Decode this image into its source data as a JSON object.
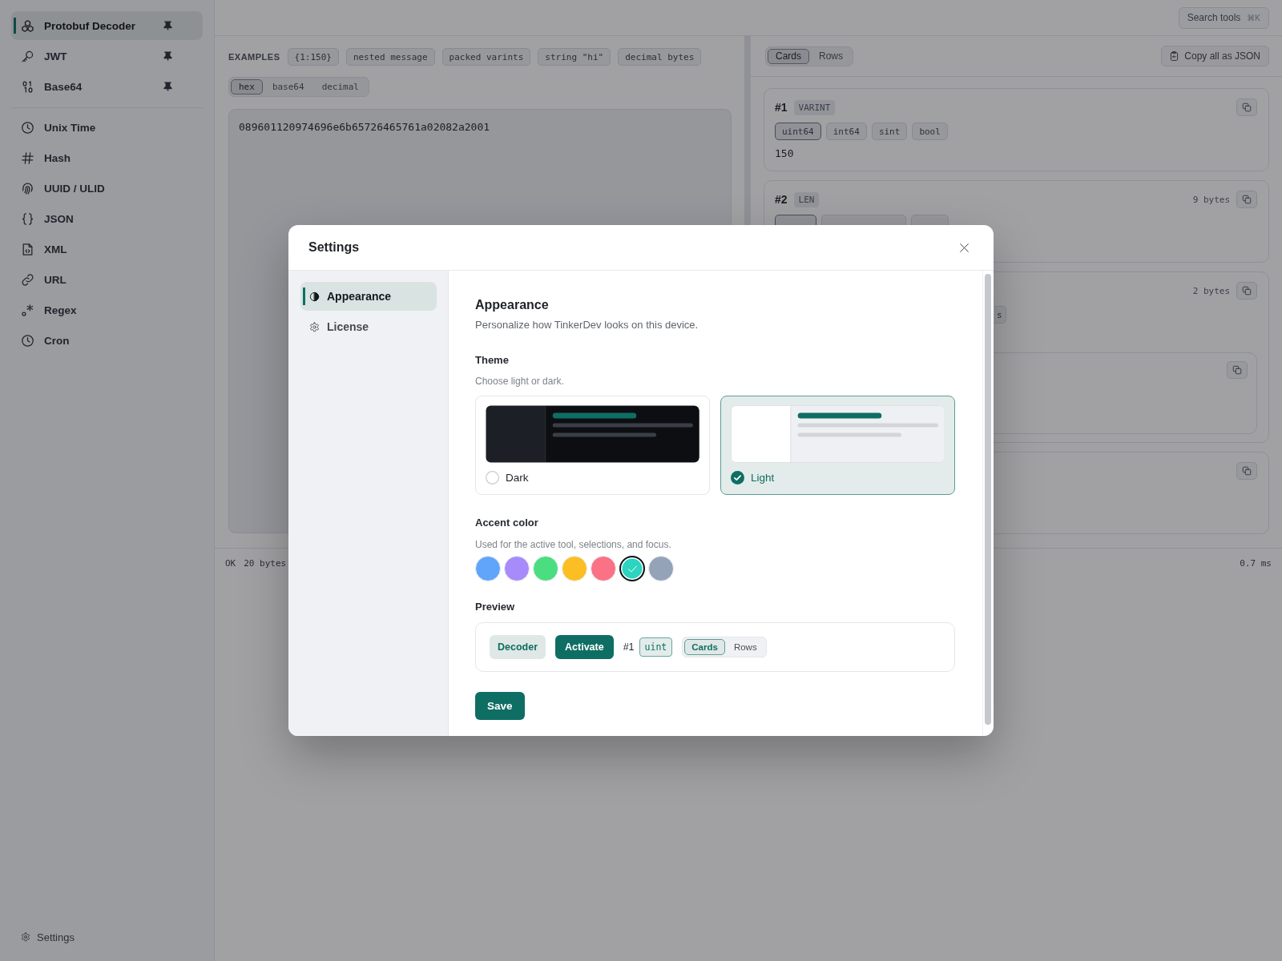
{
  "sidebar": {
    "tools": [
      {
        "label": "Protobuf Decoder",
        "selected": true,
        "pinned": true
      },
      {
        "label": "JWT",
        "selected": false,
        "pinned": true
      },
      {
        "label": "Base64",
        "selected": false,
        "pinned": true
      },
      {
        "label": "Unix Time",
        "selected": false,
        "pinned": false
      },
      {
        "label": "Hash",
        "selected": false,
        "pinned": false
      },
      {
        "label": "UUID / ULID",
        "selected": false,
        "pinned": false
      },
      {
        "label": "JSON",
        "selected": false,
        "pinned": false
      },
      {
        "label": "XML",
        "selected": false,
        "pinned": false
      },
      {
        "label": "URL",
        "selected": false,
        "pinned": false
      },
      {
        "label": "Regex",
        "selected": false,
        "pinned": false
      },
      {
        "label": "Cron",
        "selected": false,
        "pinned": false
      }
    ],
    "settings_link": "Settings"
  },
  "top_bar": {
    "search_button": {
      "label": "Search tools",
      "shortcut": "⌘K"
    }
  },
  "input_pane": {
    "examples_label": "EXAMPLES",
    "examples": [
      "{1:150}",
      "nested message",
      "packed varints",
      "string \"hi\"",
      "decimal bytes"
    ],
    "format_tabs": [
      {
        "label": "hex",
        "selected": true
      },
      {
        "label": "base64",
        "selected": false
      },
      {
        "label": "decimal",
        "selected": false
      }
    ],
    "input": {
      "value": "089601120974696e6b65726465761a02082a2001"
    }
  },
  "output_pane": {
    "view_tabs": [
      {
        "label": "Cards",
        "selected": true
      },
      {
        "label": "Rows",
        "selected": false
      }
    ],
    "copy_all_button": "Copy all as JSON",
    "fields": [
      {
        "number": "#1",
        "wire_type": "VARINT",
        "copyable": true,
        "types": [
          {
            "label": "uint64",
            "selected": true
          },
          {
            "label": "int64",
            "selected": false
          },
          {
            "label": "sint",
            "selected": false
          },
          {
            "label": "bool",
            "selected": false
          }
        ],
        "value": "150"
      },
      {
        "number": "#2",
        "wire_type": "LEN",
        "size": "9 bytes",
        "copyable": true,
        "types": [
          {
            "selected": true
          },
          {
            "selected": false
          },
          {
            "selected": false
          }
        ]
      },
      {
        "size": "2 bytes",
        "copyable": true,
        "types": [
          {
            "label": "s",
            "selected": false
          }
        ],
        "children": [
          {
            "copyable": true
          }
        ]
      },
      {
        "copyable": true
      }
    ]
  },
  "status_bar": {
    "status": "OK",
    "size": "20 bytes",
    "time": "0.7 ms"
  },
  "settings_dialog": {
    "title": "Settings",
    "nav": [
      {
        "label": "Appearance",
        "selected": true
      },
      {
        "label": "License",
        "selected": false
      }
    ],
    "heading": "Appearance",
    "description": "Personalize how TinkerDev looks on this device.",
    "theme": {
      "label": "Theme",
      "hint": "Choose light or dark.",
      "options": [
        {
          "label": "Dark",
          "kind": "dark",
          "selected": false
        },
        {
          "label": "Light",
          "kind": "light",
          "selected": true
        }
      ]
    },
    "accent": {
      "label": "Accent color",
      "hint": "Used for the active tool, selections, and focus.",
      "swatches": [
        {
          "color": "#60a5fa",
          "selected": false
        },
        {
          "color": "#a78bfa",
          "selected": false
        },
        {
          "color": "#4ade80",
          "selected": false
        },
        {
          "color": "#fbbf24",
          "selected": false
        },
        {
          "color": "#fb7185",
          "selected": false
        },
        {
          "color": "#2dd4bf",
          "selected": true
        },
        {
          "color": "#94a3b8",
          "selected": false
        }
      ]
    },
    "preview": {
      "label": "Preview",
      "tool_chip": "Decoder",
      "button": "Activate",
      "field_number": "#1",
      "type_chip": "uint",
      "view_tabs": [
        {
          "label": "Cards",
          "selected": true
        },
        {
          "label": "Rows",
          "selected": false
        }
      ]
    },
    "save_button": "Save"
  }
}
